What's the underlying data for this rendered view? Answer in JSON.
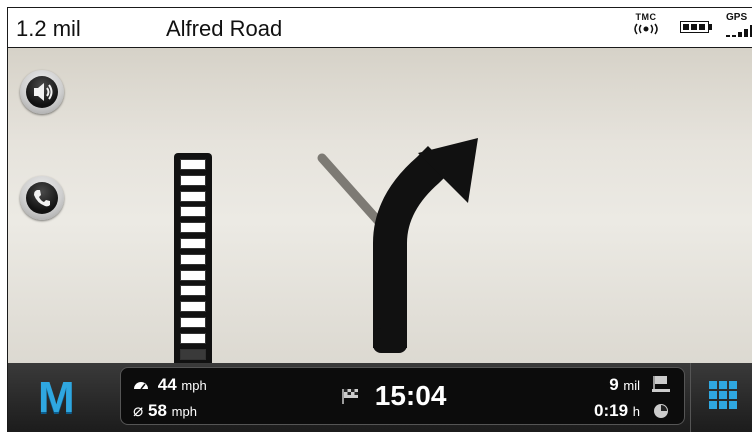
{
  "header": {
    "distance": "1.2 mil",
    "street": "Alfred Road",
    "tmc_label": "TMC",
    "gps_label": "GPS",
    "battery_icon": "battery-icon",
    "gps_icon": "gps-signal-icon"
  },
  "map": {
    "buttons": [
      {
        "name": "volume-button",
        "icon": "speaker-icon"
      },
      {
        "name": "phone-button",
        "icon": "phone-icon"
      }
    ],
    "lane_assist": {
      "segments_total": 15,
      "segments_filled": 3
    },
    "maneuver": "turn-right-arrow"
  },
  "footer": {
    "menu_label": "M",
    "speed_current": "44",
    "speed_current_unit": "mph",
    "speed_limit": "58",
    "speed_limit_unit": "mph",
    "arrival_time": "15:04",
    "distance_remaining": "9",
    "distance_unit": "mil",
    "time_remaining": "0:19",
    "time_unit": "h"
  },
  "colors": {
    "accent": "#2fa7e0",
    "bar_dark": "#1c1c1c",
    "map_bg": "#e6e3dc"
  }
}
